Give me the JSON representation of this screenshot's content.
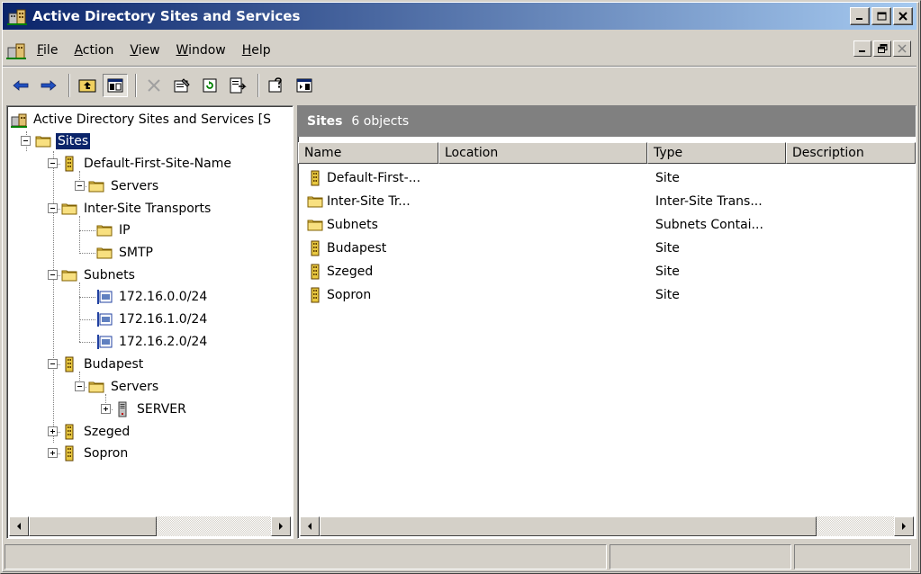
{
  "window": {
    "title": "Active Directory Sites and Services",
    "caption_buttons": [
      "minimize",
      "maximize",
      "close"
    ]
  },
  "menu": {
    "items": [
      {
        "label": "File",
        "accel": "F"
      },
      {
        "label": "Action",
        "accel": "A"
      },
      {
        "label": "View",
        "accel": "V"
      },
      {
        "label": "Window",
        "accel": "W"
      },
      {
        "label": "Help",
        "accel": "H"
      }
    ]
  },
  "toolbar": {
    "buttons": [
      "back-icon",
      "forward-icon",
      "up-folder-icon",
      "show-hide-tree-icon",
      "delete-icon",
      "properties-icon",
      "refresh-icon",
      "export-list-icon",
      "help-icon",
      "action-pane-icon"
    ]
  },
  "tree": {
    "root_label": "Active Directory Sites and Services [S",
    "nodes": [
      {
        "label": "Sites",
        "icon": "folder-icon",
        "level": 1,
        "expanded": true,
        "selected": true
      },
      {
        "label": "Default-First-Site-Name",
        "icon": "site-icon",
        "level": 2,
        "expanded": true
      },
      {
        "label": "Servers",
        "icon": "folder-icon",
        "level": 3,
        "expanded": true
      },
      {
        "label": "Inter-Site Transports",
        "icon": "folder-icon",
        "level": 2,
        "expanded": true
      },
      {
        "label": "IP",
        "icon": "folder-icon",
        "level": 3
      },
      {
        "label": "SMTP",
        "icon": "folder-icon",
        "level": 3
      },
      {
        "label": "Subnets",
        "icon": "folder-icon",
        "level": 2,
        "expanded": true
      },
      {
        "label": "172.16.0.0/24",
        "icon": "subnet-icon",
        "level": 3
      },
      {
        "label": "172.16.1.0/24",
        "icon": "subnet-icon",
        "level": 3
      },
      {
        "label": "172.16.2.0/24",
        "icon": "subnet-icon",
        "level": 3
      },
      {
        "label": "Budapest",
        "icon": "site-icon",
        "level": 2,
        "expanded": true
      },
      {
        "label": "Servers",
        "icon": "folder-icon",
        "level": 3,
        "expanded": true
      },
      {
        "label": "SERVER",
        "icon": "server-icon",
        "level": 4,
        "expanded": false
      },
      {
        "label": "Szeged",
        "icon": "site-icon",
        "level": 2,
        "expanded": false
      },
      {
        "label": "Sopron",
        "icon": "site-icon",
        "level": 2,
        "expanded": false
      }
    ]
  },
  "details": {
    "title": "Sites",
    "count": "6 objects",
    "columns": [
      "Name",
      "Location",
      "Type",
      "Description"
    ],
    "rows": [
      {
        "name": "Default-First-...",
        "location": "",
        "type": "Site",
        "description": "",
        "icon": "site-icon"
      },
      {
        "name": "Inter-Site Tr...",
        "location": "",
        "type": "Inter-Site Trans...",
        "description": "",
        "icon": "folder-icon"
      },
      {
        "name": "Subnets",
        "location": "",
        "type": "Subnets Contai...",
        "description": "",
        "icon": "folder-icon"
      },
      {
        "name": "Budapest",
        "location": "",
        "type": "Site",
        "description": "",
        "icon": "site-icon"
      },
      {
        "name": "Szeged",
        "location": "",
        "type": "Site",
        "description": "",
        "icon": "site-icon"
      },
      {
        "name": "Sopron",
        "location": "",
        "type": "Site",
        "description": "",
        "icon": "site-icon"
      }
    ]
  },
  "statusbar": {
    "panes": [
      "",
      "",
      ""
    ]
  },
  "colors": {
    "titlebar_start": "#0a246a",
    "titlebar_end": "#a6caf0",
    "selection": "#0a246a",
    "face": "#d4d0c8",
    "details_header": "#808080"
  }
}
